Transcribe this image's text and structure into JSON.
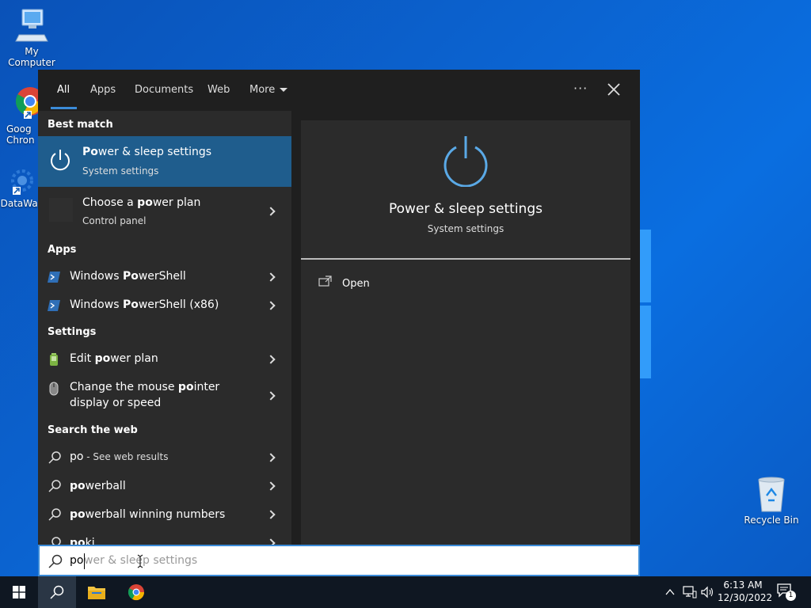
{
  "desktop": {
    "icons": [
      {
        "label": "My Computer"
      },
      {
        "label": "Goog Chron"
      },
      {
        "label": "DataWag"
      },
      {
        "label": "Recycle Bin"
      }
    ]
  },
  "search_panel": {
    "tabs": [
      {
        "label": "All",
        "active": true
      },
      {
        "label": "Apps"
      },
      {
        "label": "Documents"
      },
      {
        "label": "Web"
      },
      {
        "label": "More"
      }
    ],
    "more_options_glyph": "···",
    "sections": {
      "best_match": "Best match",
      "apps": "Apps",
      "settings": "Settings",
      "search_web": "Search the web"
    },
    "best_match": [
      {
        "title": "Power & sleep settings",
        "subtitle": "System settings",
        "icon": "power-icon",
        "selected": true
      },
      {
        "title": "Choose a power plan",
        "subtitle": "Control panel",
        "icon": "control-panel-icon"
      }
    ],
    "apps": [
      {
        "title": "Windows PowerShell",
        "icon": "powershell-icon"
      },
      {
        "title": "Windows PowerShell (x86)",
        "icon": "powershell-icon"
      }
    ],
    "settings": [
      {
        "title": "Edit power plan",
        "icon": "battery-icon"
      },
      {
        "title": "Change the mouse pointer display or speed",
        "line1": "Change the mouse pointer",
        "line2": "display or speed",
        "icon": "mouse-icon"
      }
    ],
    "web": [
      {
        "title": "po",
        "suffix": " - See web results"
      },
      {
        "title": "powerball"
      },
      {
        "title": "powerball winning numbers"
      },
      {
        "title": "poki"
      }
    ],
    "detail": {
      "title": "Power & sleep settings",
      "subtitle": "System settings",
      "action": "Open"
    }
  },
  "search_box": {
    "typed": "po",
    "suggestion": "wer & sleep settings"
  },
  "taskbar": {
    "time": "6:13 AM",
    "date": "12/30/2022",
    "notification_count": "1"
  }
}
